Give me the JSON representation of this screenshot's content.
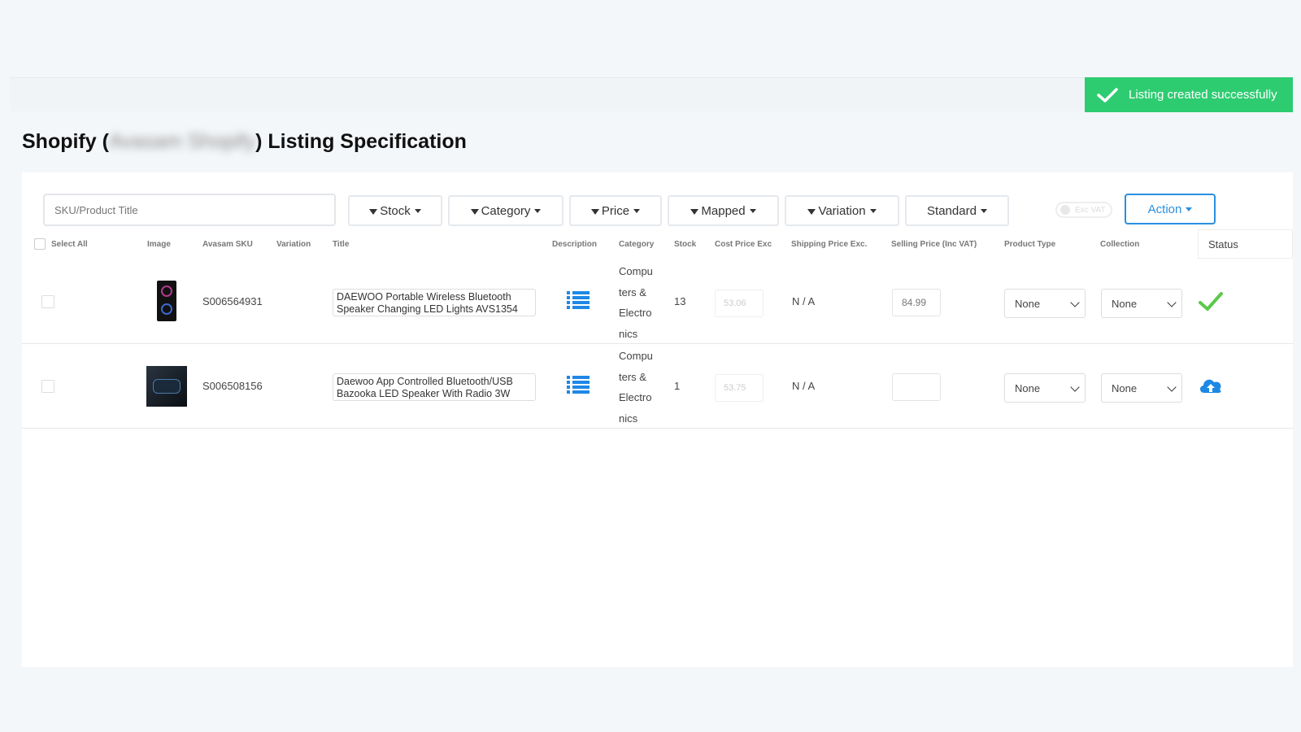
{
  "toast": {
    "message": "Listing created successfully"
  },
  "page": {
    "title_prefix": "Shopify (",
    "title_account": "Avasam Shopify",
    "title_suffix": ") Listing Specification"
  },
  "filters": {
    "search_placeholder": "SKU/Product Title",
    "stock": "Stock",
    "category": "Category",
    "price": "Price",
    "mapped": "Mapped",
    "variation": "Variation",
    "standard": "Standard",
    "vat_toggle": "Exc VAT",
    "action": "Action"
  },
  "columns": {
    "select_all": "Select All",
    "image": "Image",
    "sku": "Avasam SKU",
    "variation": "Variation",
    "title": "Title",
    "description": "Description",
    "category": "Category",
    "stock": "Stock",
    "cost": "Cost Price Exc",
    "shipping": "Shipping Price Exc.",
    "selling": "Selling Price (Inc VAT)",
    "product_type": "Product Type",
    "collection": "Collection",
    "status": "Status"
  },
  "rows": [
    {
      "sku": "S006564931",
      "title": "DAEWOO  Portable Wireless Bluetooth Speaker Changing LED Lights AVS1354",
      "category_lines": [
        "Compu",
        "ters &",
        "Electro",
        "nics"
      ],
      "stock": "13",
      "cost": "53.06",
      "shipping": "N / A",
      "selling": "84.99",
      "product_type": "None",
      "collection": "None",
      "status": "listed-check-icon"
    },
    {
      "sku": "S006508156",
      "title": "Daewoo App Controlled Bluetooth/USB Bazooka LED Speaker With Radio 3W",
      "category_lines": [
        "Compu",
        "ters &",
        "Electro",
        "nics"
      ],
      "stock": "1",
      "cost": "53.75",
      "shipping": "N / A",
      "selling": "",
      "product_type": "None",
      "collection": "None",
      "status": "upload-cloud-icon"
    }
  ],
  "colors": {
    "success": "#2ecc71",
    "accent": "#2a8fe0"
  }
}
